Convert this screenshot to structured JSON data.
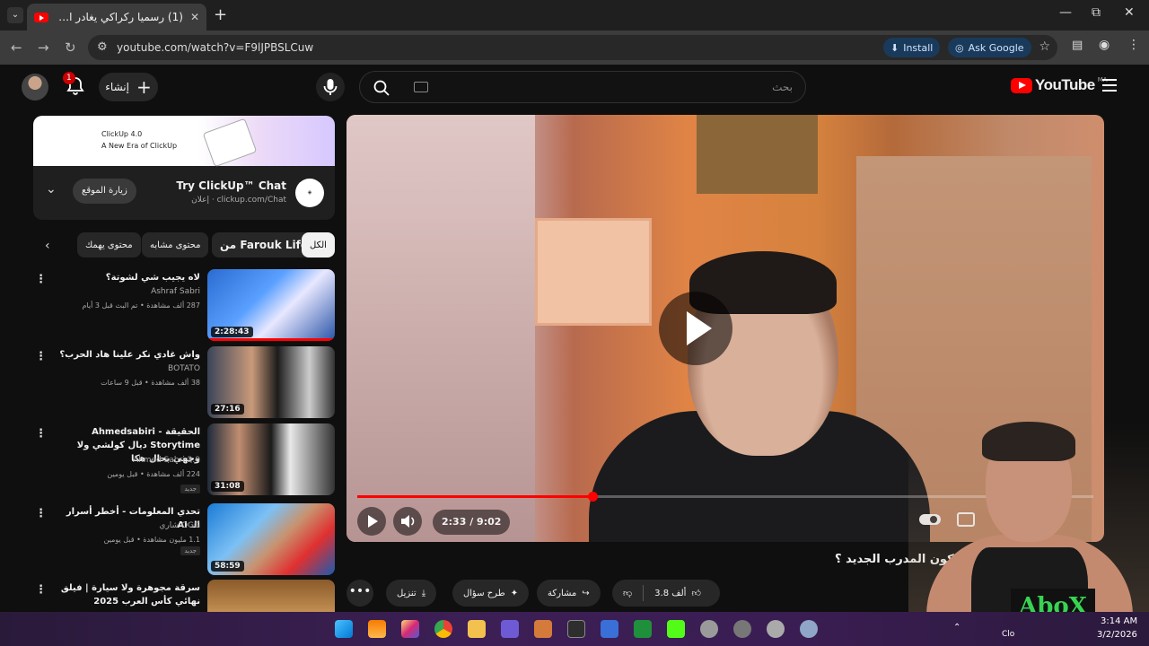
{
  "browser": {
    "tab_title": "(1) رسميا ركراكي يغادر المنتخب !",
    "tab_close": "✕",
    "new_tab": "+",
    "url": "youtube.com/watch?v=F9lJPBSLCuw",
    "install_label": "Install",
    "ask_google_label": "Ask Google",
    "win_min": "—",
    "win_max": "⧉",
    "win_close": "✕"
  },
  "header": {
    "notification_count": "1",
    "create_label": "إنشاء",
    "search_placeholder": "بحث",
    "logo_text": "YouTube",
    "country_code": "MA"
  },
  "ad": {
    "banner_line1": "ClickUp 4.0",
    "banner_line2": "A New Era of ClickUp",
    "title": "Try ClickUp™ Chat",
    "url": "إعلان · clickup.com/Chat",
    "visit_label": "زيارة الموقع",
    "logo_text": "ClickUp"
  },
  "chips": [
    {
      "label": "الكل"
    },
    {
      "label": "من Farouk Life"
    },
    {
      "label": "محتوى مشابه"
    },
    {
      "label": "محتوى يهمك"
    }
  ],
  "videos": [
    {
      "title": "لاه يجيب شي لشوتة؟",
      "channel": "Ashraf Sabri",
      "meta": "287 ألف مشاهدة • تم البث قبل 3 أيام",
      "duration": "2:28:43",
      "badge": ""
    },
    {
      "title": "واش غادي نكر علينا هاد الحرب؟",
      "channel": "BOTATO",
      "meta": "38 ألف مشاهدة • قبل 9 ساعات",
      "duration": "27:16",
      "badge": ""
    },
    {
      "title": "الحقيقة - Ahmedsabiri Storytime ديال كولشي ولا وجهي بحال هكا",
      "channel": "Ahmed Sabri 2.0",
      "meta": "224 ألف مشاهدة • قبل يومين",
      "duration": "31:08",
      "badge": "جديد"
    },
    {
      "title": "تحدي المعلومات - أخطر أسرار الـ AI",
      "channel": "شاري OGG",
      "meta": "1.1 مليون مشاهدة • قبل يومين",
      "duration": "58:59",
      "badge": "جديد"
    },
    {
      "title": "سرقة مجوهرة ولا سيارة | فيلق نهائي كأس العرب 2025",
      "channel": "",
      "meta": "",
      "duration": "",
      "badge": ""
    }
  ],
  "player": {
    "time": "2:33 / 9:02",
    "progress": 0.32,
    "buffer": 0.57
  },
  "video": {
    "title": "كون المدرب الجديد ؟",
    "like_label": "3.8 ألف",
    "share_label": "مشاركة",
    "ask_label": "طرح سؤال",
    "download_label": "تنزيل",
    "more_label": "•••"
  },
  "webcam": {
    "brand": "AboX"
  },
  "taskbar": {
    "time": "3:14 AM",
    "date": "3/2/2026",
    "weather_label": "Clo"
  },
  "colors": {
    "accent": "#ff0000",
    "background": "#0f0f0f",
    "chip": "#272727",
    "taskbar": "#3c1f55"
  }
}
